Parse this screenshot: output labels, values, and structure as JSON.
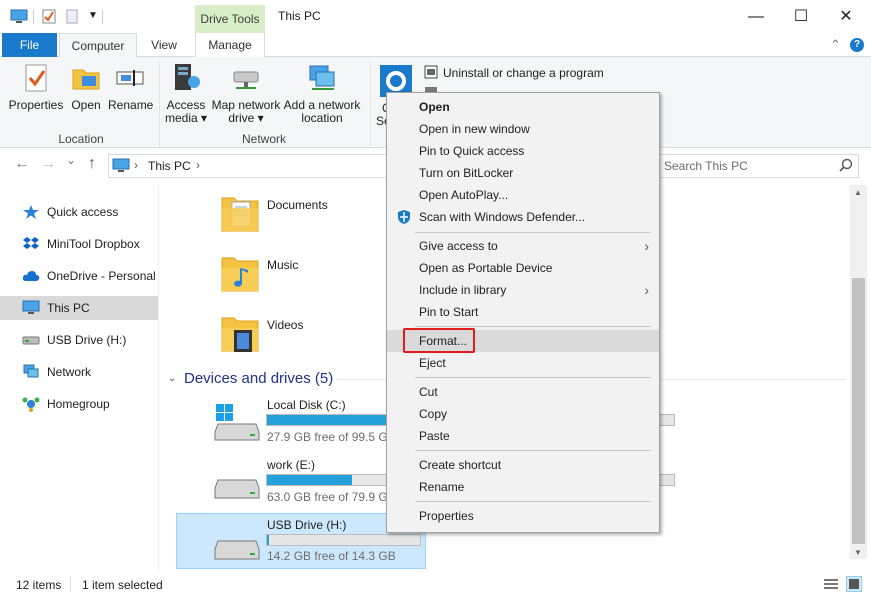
{
  "window": {
    "title": "This PC",
    "context_tab_group": "Drive Tools",
    "controls": {
      "minimize": "—",
      "maximize": "☐",
      "close": "✕"
    }
  },
  "ribbon": {
    "tabs": [
      "File",
      "Computer",
      "View",
      "Manage"
    ],
    "location_group": {
      "label": "Location",
      "buttons": [
        "Properties",
        "Open",
        "Rename"
      ]
    },
    "network_group": {
      "label": "Network",
      "buttons": [
        {
          "line1": "Access",
          "line2": "media ▾"
        },
        {
          "line1": "Map network",
          "line2": "drive ▾"
        },
        {
          "line1": "Add a network",
          "line2": "location"
        }
      ]
    },
    "system_group": {
      "settings_partial_1": "O",
      "settings_partial_2": "Se",
      "uninstall_label": "Uninstall or change a program",
      "hidden_label": "S"
    },
    "expand_symbol": "⌃",
    "help_symbol": "?"
  },
  "navigation": {
    "back": "←",
    "forward": "→",
    "dropdown": "⌄",
    "up": "↑",
    "address_path": "This PC",
    "address_sep1": "›",
    "address_sep2": "›",
    "search_placeholder": "Search This PC"
  },
  "sidebar": {
    "items": [
      {
        "label": "Quick access",
        "icon": "star-icon"
      },
      {
        "label": "MiniTool Dropbox",
        "icon": "dropbox-icon"
      },
      {
        "label": "OneDrive - Personal",
        "icon": "cloud-icon"
      },
      {
        "label": "This PC",
        "icon": "computer-icon"
      },
      {
        "label": "USB Drive (H:)",
        "icon": "usb-drive-icon"
      },
      {
        "label": "Network",
        "icon": "network-icon"
      },
      {
        "label": "Homegroup",
        "icon": "homegroup-icon"
      }
    ]
  },
  "content": {
    "folders": [
      "Documents",
      "Music",
      "Videos"
    ],
    "devices_header": "Devices and drives (5)",
    "drives": [
      {
        "name": "Local Disk (C:)",
        "free": "27.9 GB free of 99.5 GB",
        "used_fraction": 0.72
      },
      {
        "name": "work (E:)",
        "free": "63.0 GB free of 79.9 GB",
        "used_fraction": 0.21
      },
      {
        "name": "USB Drive (H:)",
        "free": "14.2 GB free of 14.3 GB",
        "used_fraction": 0.01
      }
    ]
  },
  "status": {
    "items": "12 items",
    "selected": "1 item selected"
  },
  "context_menu": {
    "groups": [
      [
        "Open",
        "Open in new window",
        "Pin to Quick access",
        "Turn on BitLocker",
        "Open AutoPlay...",
        "Scan with Windows Defender..."
      ],
      [
        "Give access to",
        "Open as Portable Device",
        "Include in library",
        "Pin to Start"
      ],
      [
        "Format...",
        "Eject"
      ],
      [
        "Cut",
        "Copy",
        "Paste"
      ],
      [
        "Create shortcut",
        "Rename"
      ],
      [
        "Properties"
      ]
    ],
    "submenu_arrow": "›"
  },
  "colors": {
    "accent": "#1979ca",
    "selection": "#cce8ff",
    "drive_bar": "#26a0da",
    "highlight_border": "#e21b1b",
    "context_tab": "#d8eec6"
  }
}
